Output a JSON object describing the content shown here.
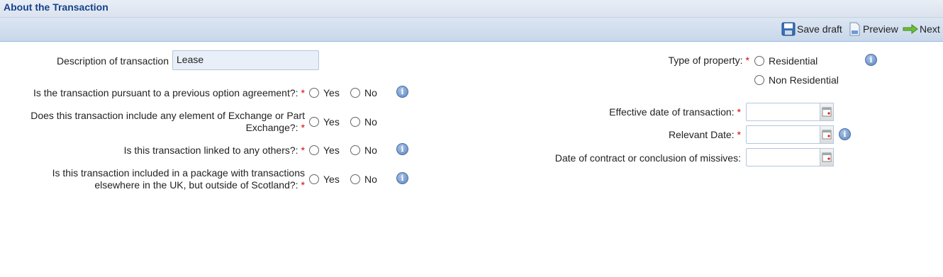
{
  "header": {
    "title": "About the Transaction"
  },
  "toolbar": {
    "save_draft": "Save draft",
    "preview": "Preview",
    "next": "Next"
  },
  "left": {
    "description": {
      "label": "Description of transaction",
      "value": "Lease"
    },
    "q1": {
      "line1": "Is the transaction pursuant to a previous option agreement?:",
      "yes": "Yes",
      "no": "No"
    },
    "q2": {
      "line1": "Does this transaction include any element of Exchange or Part",
      "line2": "Exchange?:",
      "yes": "Yes",
      "no": "No"
    },
    "q3": {
      "line1": "Is this transaction linked to any others?:",
      "yes": "Yes",
      "no": "No"
    },
    "q4": {
      "line1": "Is this transaction included in a package with transactions",
      "line2": "elsewhere in the UK, but outside of Scotland?:",
      "yes": "Yes",
      "no": "No"
    }
  },
  "right": {
    "property_type": {
      "label": "Type of property:",
      "option1": "Residential",
      "option2": "Non Residential"
    },
    "effective_date": {
      "label": "Effective date of transaction:"
    },
    "relevant_date": {
      "label": "Relevant Date:"
    },
    "contract_date": {
      "label": "Date of contract or conclusion of missives:"
    }
  },
  "required_marker": "*",
  "info_glyph": "i",
  "colors": {
    "title": "#15428b",
    "required": "#dd0000",
    "info": "#5d86c0"
  }
}
